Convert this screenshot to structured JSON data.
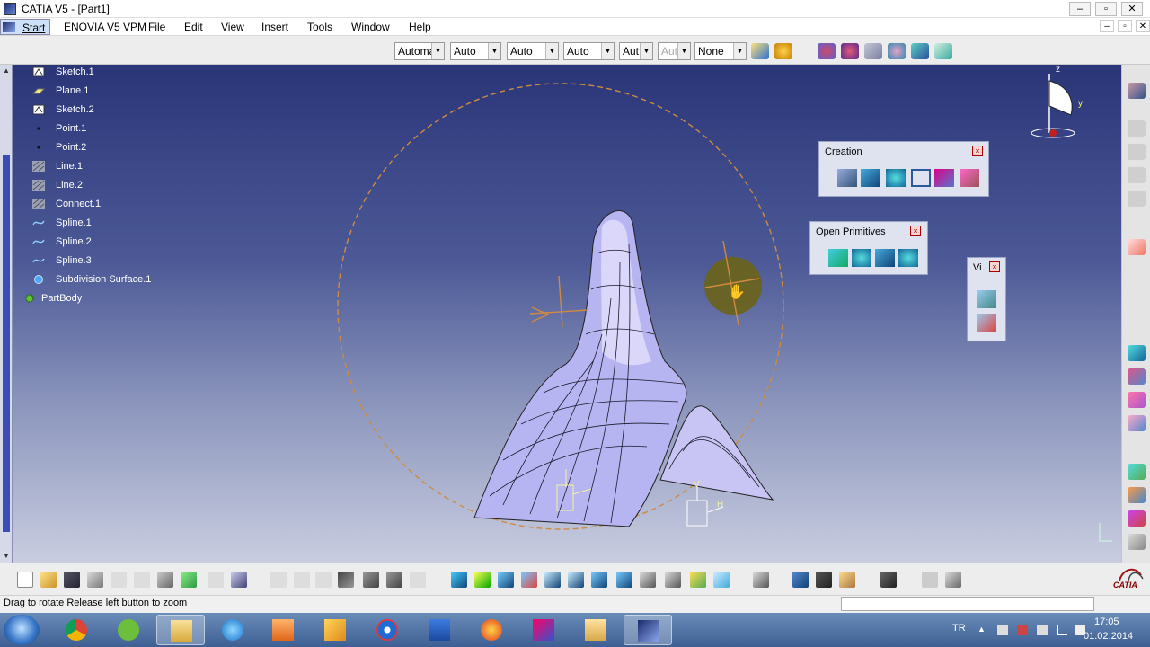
{
  "window": {
    "title": "CATIA V5 - [Part1]"
  },
  "menubar": {
    "start": "Start",
    "items": [
      "ENOVIA V5 VPM",
      "File",
      "Edit",
      "View",
      "Insert",
      "Tools",
      "Window",
      "Help"
    ]
  },
  "toolbar": {
    "combos": [
      {
        "value": "Automa",
        "disabled": false
      },
      {
        "value": "Auto",
        "disabled": false
      },
      {
        "value": "Auto",
        "disabled": false
      },
      {
        "value": "Auto",
        "disabled": false
      },
      {
        "value": "Aut",
        "disabled": false
      },
      {
        "value": "Aut",
        "disabled": true
      },
      {
        "value": "None",
        "disabled": false
      }
    ]
  },
  "tree": {
    "items": [
      {
        "label": "Sketch.1",
        "icon": "sketch-icon"
      },
      {
        "label": "Plane.1",
        "icon": "plane-icon"
      },
      {
        "label": "Sketch.2",
        "icon": "sketch-icon"
      },
      {
        "label": "Point.1",
        "icon": "point-icon"
      },
      {
        "label": "Point.2",
        "icon": "point-icon"
      },
      {
        "label": "Line.1",
        "icon": "line-icon"
      },
      {
        "label": "Line.2",
        "icon": "line-icon"
      },
      {
        "label": "Connect.1",
        "icon": "connect-icon"
      },
      {
        "label": "Spline.1",
        "icon": "spline-icon"
      },
      {
        "label": "Spline.2",
        "icon": "spline-icon"
      },
      {
        "label": "Spline.3",
        "icon": "spline-icon"
      },
      {
        "label": "Subdivision Surface.1",
        "icon": "subdivision-surface-icon"
      }
    ],
    "body": "PartBody"
  },
  "panels": {
    "creation": {
      "title": "Creation"
    },
    "open_primitives": {
      "title": "Open Primitives"
    },
    "view": {
      "title": "Vi"
    }
  },
  "compass": {
    "z": "z",
    "y": "y"
  },
  "axis_labels": {
    "v": "V",
    "h": "H"
  },
  "status": {
    "message": "Drag to rotate  Release left button to zoom"
  },
  "logo": {
    "text": "CATIA"
  },
  "tray": {
    "lang": "TR",
    "time": "17:05",
    "date": "01.02.2014"
  },
  "colors": {
    "viewport_top": "#2a3578",
    "viewport_bottom": "#c9cde0",
    "surface": "#b7b4f2"
  }
}
